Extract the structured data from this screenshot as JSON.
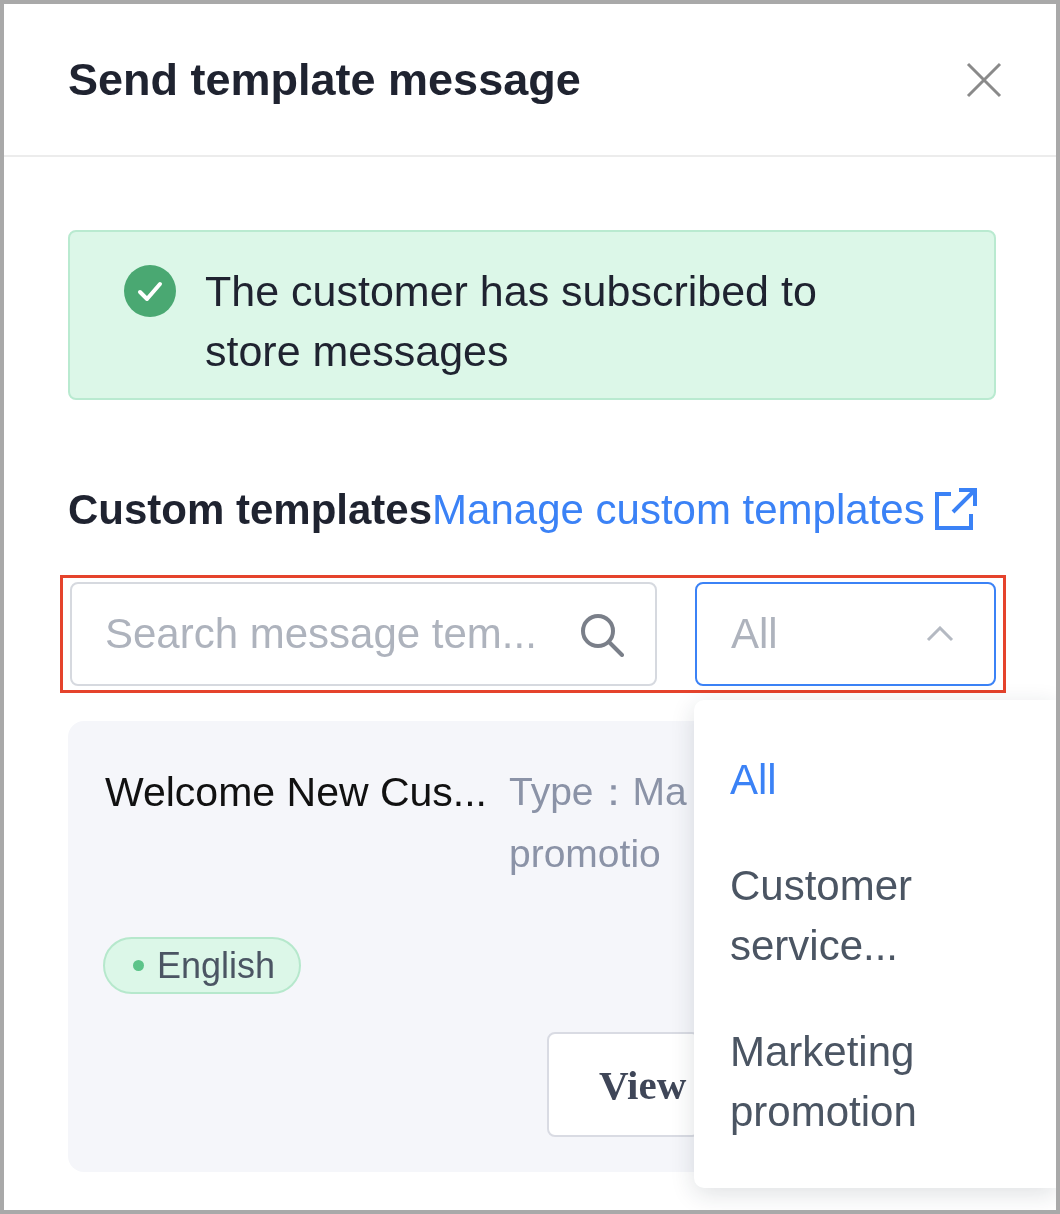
{
  "dialog": {
    "title": "Send template message"
  },
  "alert": {
    "text": "The customer has subscribed to store messages"
  },
  "section": {
    "title": "Custom templates",
    "link": "Manage custom templates"
  },
  "search": {
    "placeholder": "Search message tem..."
  },
  "type_filter": {
    "value": "All",
    "expanded": true,
    "options": [
      {
        "label": "All",
        "selected": true
      },
      {
        "label": "Customer service...",
        "selected": false
      },
      {
        "label": "Marketing promotion",
        "selected": false
      }
    ]
  },
  "templates": [
    {
      "name": "Welcome New Cus...",
      "type_lines": [
        "Type：Ma",
        "promotio"
      ],
      "language": "English",
      "button": "View"
    }
  ]
}
